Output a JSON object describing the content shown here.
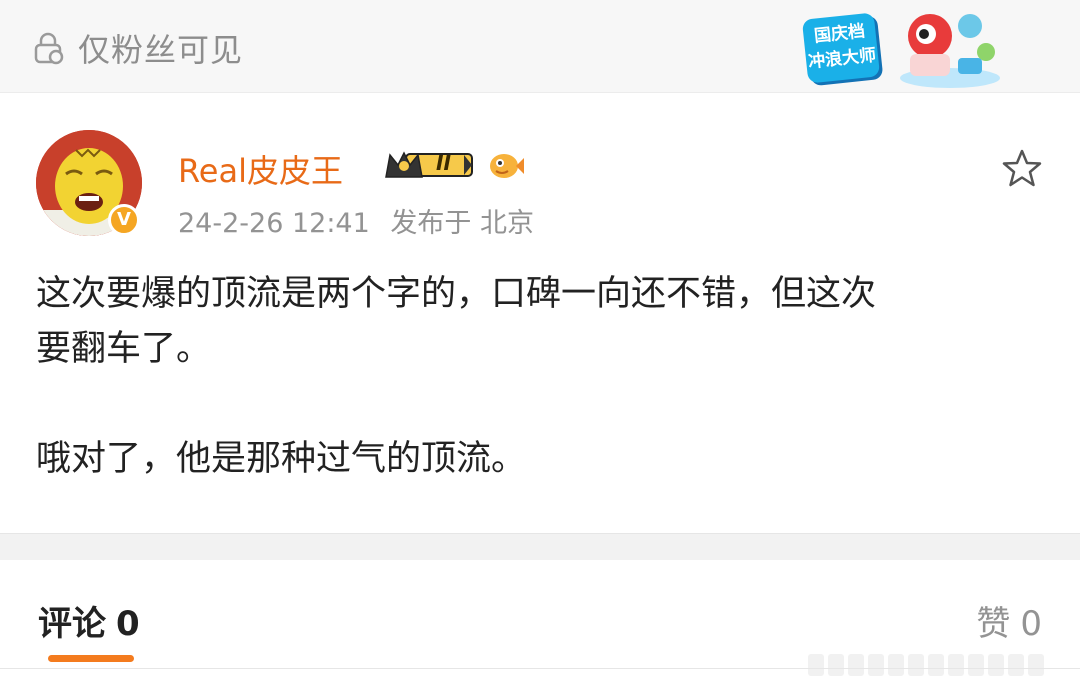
{
  "topbar": {
    "visibility_text": "仅粉丝可见",
    "promo": {
      "line1": "国庆档",
      "line2": "冲浪大师"
    }
  },
  "post": {
    "author": {
      "name": "Real皮皮王",
      "badge_level": "II",
      "verified_mark": "V"
    },
    "meta": {
      "timestamp": "24-2-26 12:41",
      "location_text": "发布于 北京"
    },
    "content": {
      "para1_line1": "这次要爆的顶流是两个字的，口碑一向还不错，但这次",
      "para1_line2": "要翻车了。",
      "para2": "哦对了，他是那种过气的顶流。"
    }
  },
  "tabs": {
    "comments_label": "评论",
    "comments_count": "0",
    "likes_label": "赞",
    "likes_count": "0"
  },
  "colors": {
    "accent": "#f47b1e",
    "username": "#e86a17",
    "muted": "#939393"
  }
}
